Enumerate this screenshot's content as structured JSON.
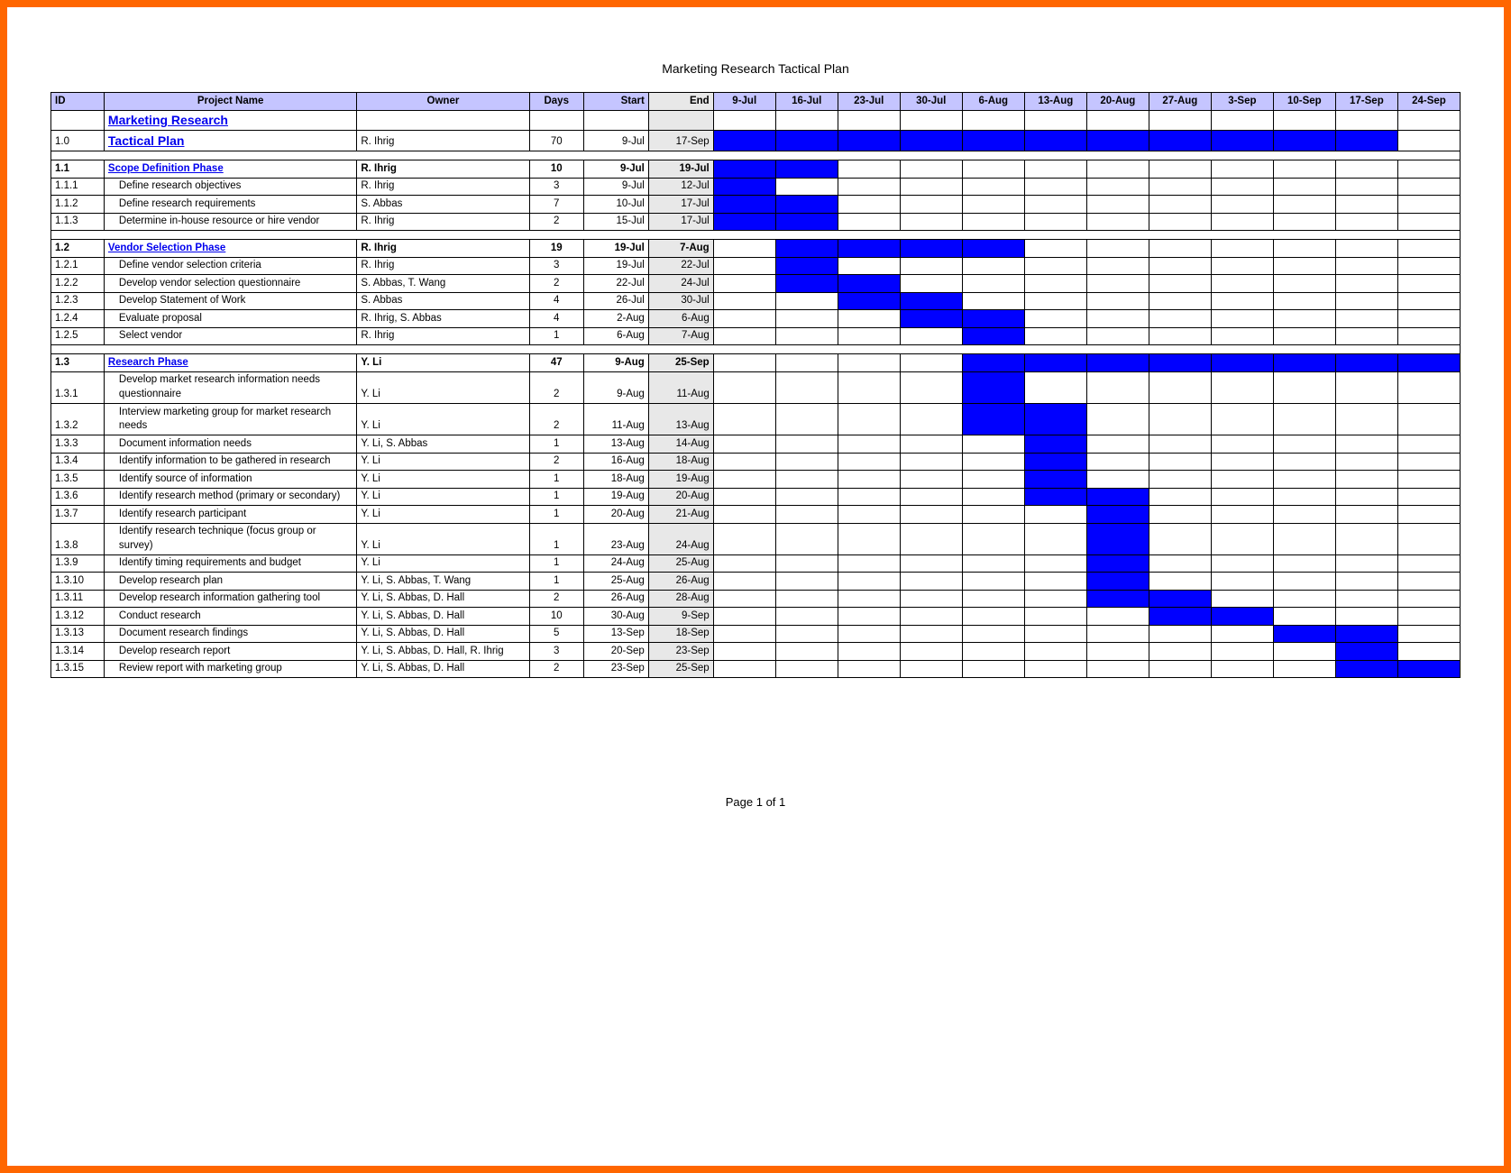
{
  "title": "Marketing Research Tactical Plan",
  "page_label": "Page 1 of 1",
  "headers": {
    "id": "ID",
    "name": "Project Name",
    "owner": "Owner",
    "days": "Days",
    "start": "Start",
    "end": "End"
  },
  "weeks": [
    "9-Jul",
    "16-Jul",
    "23-Jul",
    "30-Jul",
    "6-Aug",
    "13-Aug",
    "20-Aug",
    "27-Aug",
    "3-Sep",
    "10-Sep",
    "17-Sep",
    "24-Sep"
  ],
  "rows": [
    {
      "type": "title",
      "id": "",
      "name": "Marketing Research",
      "owner": "",
      "days": "",
      "start": "",
      "end": "",
      "gantt": []
    },
    {
      "type": "title",
      "id": "1.0",
      "name": "Tactical Plan",
      "owner": "R. Ihrig",
      "days": "70",
      "start": "9-Jul",
      "end": "17-Sep",
      "gantt": [
        0,
        1,
        2,
        3,
        4,
        5,
        6,
        7,
        8,
        9,
        10
      ]
    },
    {
      "type": "blank"
    },
    {
      "type": "phase",
      "id": "1.1",
      "name": "Scope Definition Phase",
      "owner": "R. Ihrig",
      "days": "10",
      "start": "9-Jul",
      "end": "19-Jul",
      "gantt": [
        0,
        1
      ]
    },
    {
      "type": "task",
      "id": "1.1.1",
      "name": "Define research objectives",
      "owner": "R. Ihrig",
      "days": "3",
      "start": "9-Jul",
      "end": "12-Jul",
      "gantt": [
        0
      ]
    },
    {
      "type": "task",
      "id": "1.1.2",
      "name": "Define research requirements",
      "owner": "S. Abbas",
      "days": "7",
      "start": "10-Jul",
      "end": "17-Jul",
      "gantt": [
        0,
        1
      ]
    },
    {
      "type": "task",
      "id": "1.1.3",
      "name": "Determine in-house resource or hire vendor",
      "owner": "R. Ihrig",
      "days": "2",
      "start": "15-Jul",
      "end": "17-Jul",
      "gantt": [
        0,
        1
      ]
    },
    {
      "type": "blank"
    },
    {
      "type": "phase",
      "id": "1.2",
      "name": "Vendor Selection Phase",
      "owner": "R. Ihrig",
      "days": "19",
      "start": "19-Jul",
      "end": "7-Aug",
      "gantt": [
        1,
        2,
        3,
        4
      ]
    },
    {
      "type": "task",
      "id": "1.2.1",
      "name": "Define vendor selection criteria",
      "owner": "R. Ihrig",
      "days": "3",
      "start": "19-Jul",
      "end": "22-Jul",
      "gantt": [
        1
      ]
    },
    {
      "type": "task",
      "id": "1.2.2",
      "name": "Develop vendor selection questionnaire",
      "owner": "S. Abbas, T. Wang",
      "days": "2",
      "start": "22-Jul",
      "end": "24-Jul",
      "gantt": [
        1,
        2
      ]
    },
    {
      "type": "task",
      "id": "1.2.3",
      "name": "Develop Statement of Work",
      "owner": "S. Abbas",
      "days": "4",
      "start": "26-Jul",
      "end": "30-Jul",
      "gantt": [
        2,
        3
      ]
    },
    {
      "type": "task",
      "id": "1.2.4",
      "name": "Evaluate proposal",
      "owner": "R. Ihrig, S. Abbas",
      "days": "4",
      "start": "2-Aug",
      "end": "6-Aug",
      "gantt": [
        3,
        4
      ]
    },
    {
      "type": "task",
      "id": "1.2.5",
      "name": "Select vendor",
      "owner": "R. Ihrig",
      "days": "1",
      "start": "6-Aug",
      "end": "7-Aug",
      "gantt": [
        4
      ]
    },
    {
      "type": "blank"
    },
    {
      "type": "phase",
      "id": "1.3",
      "name": "Research Phase",
      "owner": "Y. Li",
      "days": "47",
      "start": "9-Aug",
      "end": "25-Sep",
      "gantt": [
        4,
        5,
        6,
        7,
        8,
        9,
        10,
        11
      ]
    },
    {
      "type": "task",
      "id": "1.3.1",
      "name": "Develop market research information needs questionnaire",
      "owner": "Y. Li",
      "days": "2",
      "start": "9-Aug",
      "end": "11-Aug",
      "gantt": [
        4
      ]
    },
    {
      "type": "task",
      "id": "1.3.2",
      "name": "Interview marketing group for market research needs",
      "owner": "Y. Li",
      "days": "2",
      "start": "11-Aug",
      "end": "13-Aug",
      "gantt": [
        4,
        5
      ]
    },
    {
      "type": "task",
      "id": "1.3.3",
      "name": "Document information needs",
      "owner": "Y. Li, S. Abbas",
      "days": "1",
      "start": "13-Aug",
      "end": "14-Aug",
      "gantt": [
        5
      ]
    },
    {
      "type": "task",
      "id": "1.3.4",
      "name": "Identify information to be gathered in research",
      "owner": "Y. Li",
      "days": "2",
      "start": "16-Aug",
      "end": "18-Aug",
      "gantt": [
        5
      ]
    },
    {
      "type": "task",
      "id": "1.3.5",
      "name": "Identify source of information",
      "owner": "Y. Li",
      "days": "1",
      "start": "18-Aug",
      "end": "19-Aug",
      "gantt": [
        5
      ]
    },
    {
      "type": "task",
      "id": "1.3.6",
      "name": "Identify research method (primary or secondary)",
      "owner": "Y. Li",
      "days": "1",
      "start": "19-Aug",
      "end": "20-Aug",
      "gantt": [
        5,
        6
      ]
    },
    {
      "type": "task",
      "id": "1.3.7",
      "name": "Identify research participant",
      "owner": "Y. Li",
      "days": "1",
      "start": "20-Aug",
      "end": "21-Aug",
      "gantt": [
        6
      ]
    },
    {
      "type": "task",
      "id": "1.3.8",
      "name": "Identify research technique (focus group or survey)",
      "owner": "Y. Li",
      "days": "1",
      "start": "23-Aug",
      "end": "24-Aug",
      "gantt": [
        6
      ]
    },
    {
      "type": "task",
      "id": "1.3.9",
      "name": "Identify timing requirements and budget",
      "owner": "Y. Li",
      "days": "1",
      "start": "24-Aug",
      "end": "25-Aug",
      "gantt": [
        6
      ]
    },
    {
      "type": "task",
      "id": "1.3.10",
      "name": "Develop research plan",
      "owner": "Y. Li, S. Abbas, T. Wang",
      "days": "1",
      "start": "25-Aug",
      "end": "26-Aug",
      "gantt": [
        6
      ]
    },
    {
      "type": "task",
      "id": "1.3.11",
      "name": "Develop research information gathering tool",
      "owner": "Y. Li, S. Abbas, D. Hall",
      "days": "2",
      "start": "26-Aug",
      "end": "28-Aug",
      "gantt": [
        6,
        7
      ]
    },
    {
      "type": "task",
      "id": "1.3.12",
      "name": "Conduct research",
      "owner": "Y. Li, S. Abbas, D. Hall",
      "days": "10",
      "start": "30-Aug",
      "end": "9-Sep",
      "gantt": [
        7,
        8
      ]
    },
    {
      "type": "task",
      "id": "1.3.13",
      "name": "Document research findings",
      "owner": "Y. Li, S. Abbas, D. Hall",
      "days": "5",
      "start": "13-Sep",
      "end": "18-Sep",
      "gantt": [
        9,
        10
      ]
    },
    {
      "type": "task",
      "id": "1.3.14",
      "name": "Develop research report",
      "owner": "Y. Li, S. Abbas, D. Hall, R. Ihrig",
      "days": "3",
      "start": "20-Sep",
      "end": "23-Sep",
      "gantt": [
        10
      ]
    },
    {
      "type": "task",
      "id": "1.3.15",
      "name": "Review report with marketing group",
      "owner": "Y. Li, S. Abbas, D. Hall",
      "days": "2",
      "start": "23-Sep",
      "end": "25-Sep",
      "gantt": [
        10,
        11
      ]
    }
  ]
}
